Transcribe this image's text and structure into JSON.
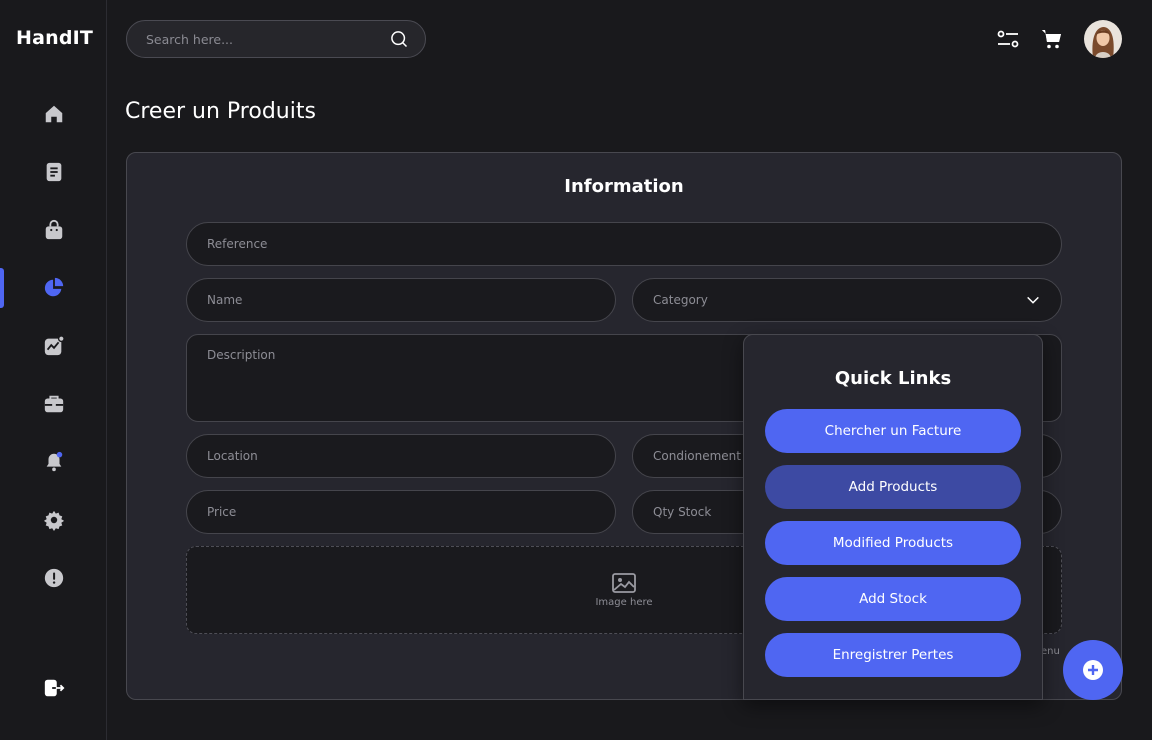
{
  "app": {
    "name": "HandIT"
  },
  "search": {
    "placeholder": "Search here..."
  },
  "page": {
    "title": "Creer un Produits"
  },
  "form": {
    "section_title": "Information",
    "reference_placeholder": "Reference",
    "name_placeholder": "Name",
    "category_label": "Category",
    "description_placeholder": "Description",
    "location_placeholder": "Location",
    "conditionnement_placeholder": "Condionement",
    "price_placeholder": "Price",
    "qty_stock_placeholder": "Qty Stock",
    "image_label": "Image here",
    "menu_text": "enu"
  },
  "quick_links": {
    "title": "Quick Links",
    "items": [
      {
        "label": "Chercher un Facture"
      },
      {
        "label": "Add Products"
      },
      {
        "label": "Modified Products"
      },
      {
        "label": "Add Stock"
      },
      {
        "label": "Enregistrer Pertes"
      }
    ]
  },
  "sidebar": {
    "items": [
      "home-icon",
      "document-icon",
      "shopping-bag-icon",
      "pie-chart-icon",
      "analytics-icon",
      "briefcase-icon",
      "notification-bell-icon",
      "settings-gear-icon",
      "info-alert-icon"
    ],
    "active": "pie-chart-icon"
  },
  "colors": {
    "accent": "#4f66f2",
    "background": "#19191c",
    "panel": "#26262e",
    "icon_grey": "#c8c8cc"
  }
}
